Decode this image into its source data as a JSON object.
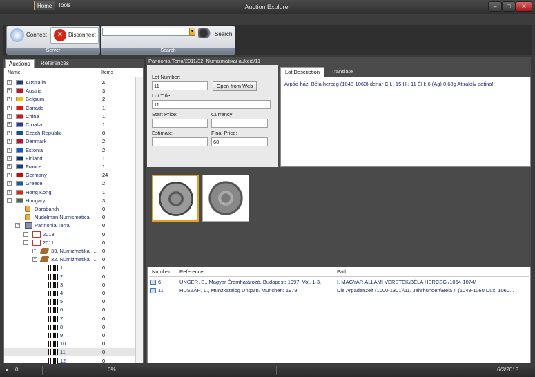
{
  "window": {
    "title": "Auction Explorer",
    "minimize": "–",
    "maximize": "□",
    "close": "✕"
  },
  "menu": {
    "home": "Home",
    "tools": "Tools"
  },
  "ribbon": {
    "server_group": "Server",
    "connect": "Connect",
    "disconnect": "Disconnect",
    "search_group": "Search",
    "search_button": "Search",
    "search_value": ""
  },
  "left_tabs": {
    "auctions": "Auctions",
    "references": "References"
  },
  "tree": {
    "col_name": "Name",
    "col_items": "Items",
    "countries": [
      {
        "name": "Australia",
        "count": "4",
        "flag": "#1a3a8a"
      },
      {
        "name": "Austria",
        "count": "3",
        "flag": "#c8102e"
      },
      {
        "name": "Belgium",
        "count": "2",
        "flag": "#f2c000"
      },
      {
        "name": "Canada",
        "count": "1",
        "flag": "#e11"
      },
      {
        "name": "China",
        "count": "1",
        "flag": "#d11"
      },
      {
        "name": "Croatia",
        "count": "1",
        "flag": "#2040a0"
      },
      {
        "name": "Czech Republic",
        "count": "8",
        "flag": "#1050a0"
      },
      {
        "name": "Denmark",
        "count": "2",
        "flag": "#c8102e"
      },
      {
        "name": "Estonia",
        "count": "2",
        "flag": "#0a60c8"
      },
      {
        "name": "Finland",
        "count": "1",
        "flag": "#003580"
      },
      {
        "name": "France",
        "count": "1",
        "flag": "#0040a0"
      },
      {
        "name": "Germany",
        "count": "24",
        "flag": "#dd0000"
      },
      {
        "name": "Greece",
        "count": "2",
        "flag": "#0d5eaf"
      },
      {
        "name": "Hong Kong",
        "count": "1",
        "flag": "#de2910"
      },
      {
        "name": "Hungary",
        "count": "3",
        "flag": "#436f4d"
      }
    ],
    "hungary_children": [
      {
        "name": "Darabanth",
        "count": "0"
      },
      {
        "name": "Nudelman Numismatica",
        "count": "0"
      },
      {
        "name": "Pannonia Terra",
        "count": "0"
      }
    ],
    "years": [
      {
        "name": "2013",
        "count": "0"
      },
      {
        "name": "2011",
        "count": "0"
      }
    ],
    "auctions": [
      {
        "name": "33. Numizmatikai ...",
        "count": "0"
      },
      {
        "name": "32. Numizmatikai ...",
        "count": "0"
      }
    ],
    "lots": [
      {
        "name": "1",
        "count": "0"
      },
      {
        "name": "2",
        "count": "0"
      },
      {
        "name": "3",
        "count": "0"
      },
      {
        "name": "4",
        "count": "0"
      },
      {
        "name": "5",
        "count": "0"
      },
      {
        "name": "6",
        "count": "0"
      },
      {
        "name": "7",
        "count": "0"
      },
      {
        "name": "8",
        "count": "0"
      },
      {
        "name": "9",
        "count": "0"
      },
      {
        "name": "10",
        "count": "0"
      },
      {
        "name": "11",
        "count": "0"
      },
      {
        "name": "12",
        "count": "0"
      }
    ]
  },
  "breadcrumb": "Pannonia Terra/2011/32. Numizmatikai aukció/11",
  "lot": {
    "number_label": "Lot Number:",
    "number": "11",
    "open_web": "Open from Web",
    "title_label": "Lot Title:",
    "title": "11",
    "start_label": "Start Price:",
    "start": "",
    "currency_label": "Currency:",
    "currency": "",
    "estimate_label": "Estimate:",
    "estimate": "",
    "final_label": "Final Price:",
    "final": "60"
  },
  "desc_tabs": {
    "lot_description": "Lot Description",
    "translate": "Translate"
  },
  "description": "Árpád-ház, Béla herceg (1048-1060)  denár  C.I.: 15 H.: 11 ÉH: 6 (Ag) 0.68g Attraktív patina!",
  "refs": {
    "headers": {
      "number": "Number",
      "reference": "Reference",
      "path": "Path"
    },
    "rows": [
      {
        "number": "6",
        "reference": "UNGER, E.,  Magyar Éremhatározó. Budapest: 1997. Vol. 1-3.",
        "path": "I. MAGYAR ÁLLAMI VERETEK\\BÉLA HERCEG /1064-1074/"
      },
      {
        "number": "11",
        "reference": "HUSZÁR, L.,  Münzkatalog Ungarn. München: 1979.",
        "path": "Die Arpadenzeit (1000-1301)\\11. Jahrhundert\\Béla I. (1048-1060 Dux, 1060..."
      }
    ]
  },
  "status": {
    "count": "0",
    "progress": "0%",
    "date": "6/3/2013"
  }
}
